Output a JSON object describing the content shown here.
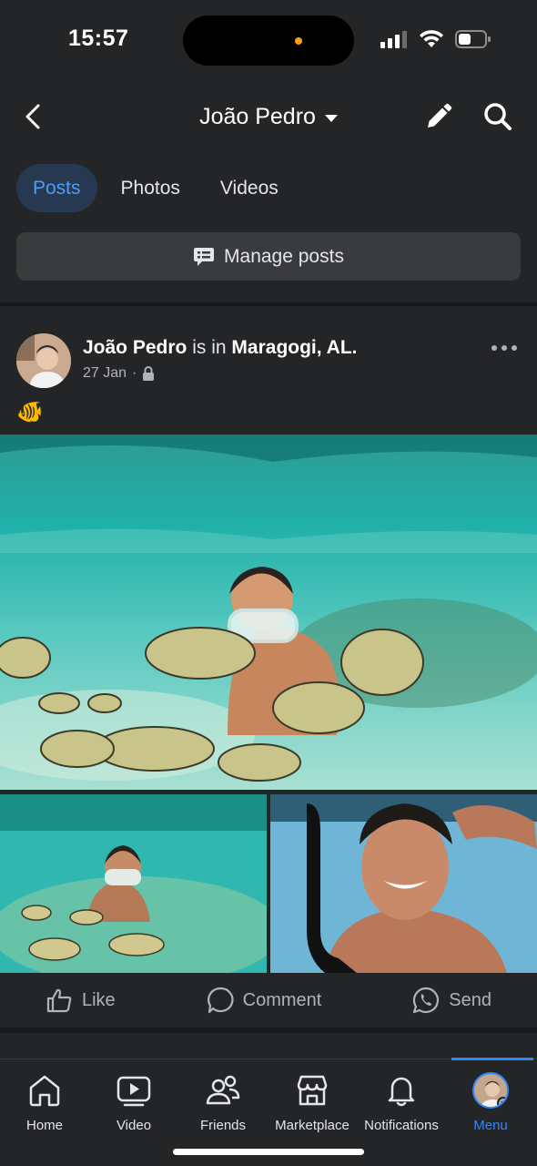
{
  "status_bar": {
    "time": "15:57"
  },
  "header": {
    "title": "João Pedro"
  },
  "tabs": [
    {
      "label": "Posts",
      "active": true
    },
    {
      "label": "Photos",
      "active": false
    },
    {
      "label": "Videos",
      "active": false
    }
  ],
  "manage_posts": {
    "label": "Manage posts"
  },
  "post": {
    "author": "João Pedro",
    "connector": "is in",
    "location": "Maragogi, AL.",
    "date": "27 Jan",
    "privacy_icon": "lock-icon",
    "emoji": "🐠",
    "actions": {
      "like": "Like",
      "comment": "Comment",
      "send": "Send"
    }
  },
  "bottom_nav": {
    "items": [
      {
        "label": "Home",
        "icon": "home-icon"
      },
      {
        "label": "Video",
        "icon": "video-icon"
      },
      {
        "label": "Friends",
        "icon": "friends-icon"
      },
      {
        "label": "Marketplace",
        "icon": "marketplace-icon"
      },
      {
        "label": "Notifications",
        "icon": "bell-icon"
      },
      {
        "label": "Menu",
        "icon": "avatar-menu",
        "active": true
      }
    ]
  },
  "colors": {
    "background": "#242526",
    "accent": "#2d88ff",
    "tab_active_bg": "#263951",
    "button_bg": "#3a3b3c"
  }
}
